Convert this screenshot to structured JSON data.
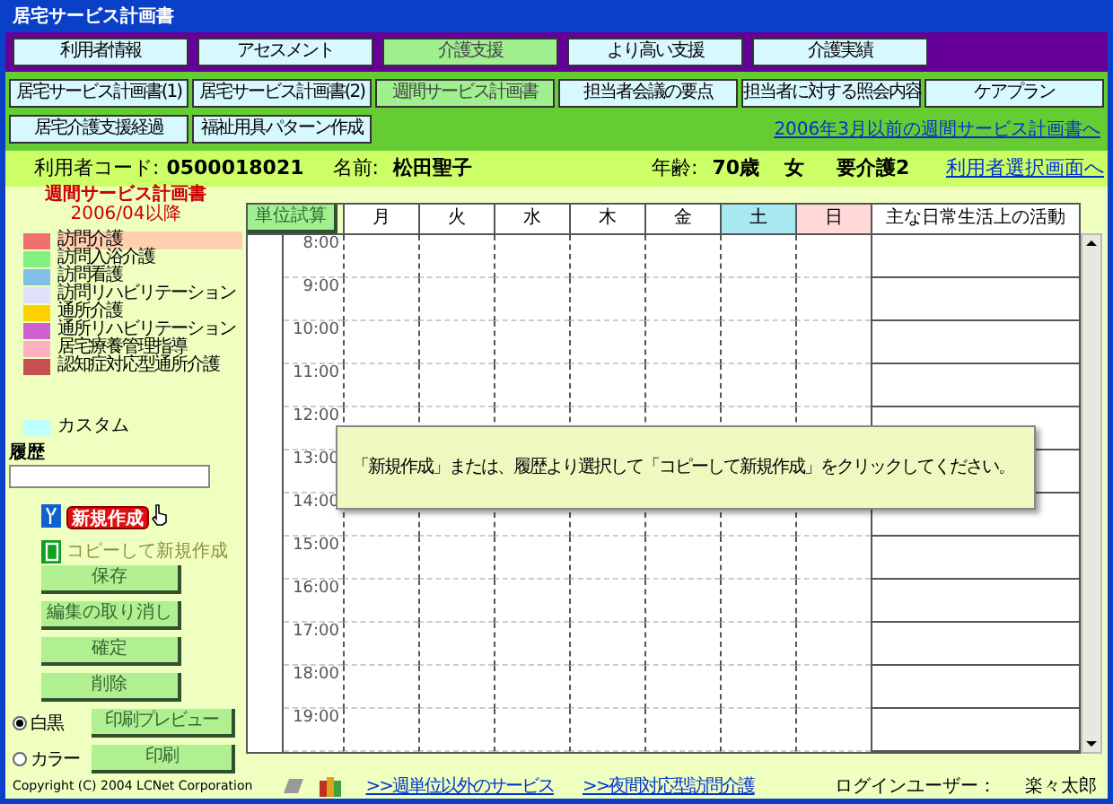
{
  "window": {
    "title": "居宅サービス計画書"
  },
  "top_tabs": [
    {
      "label": "利用者情報",
      "selected": false
    },
    {
      "label": "アセスメント",
      "selected": false
    },
    {
      "label": "介護支援",
      "selected": true
    },
    {
      "label": "より高い支援",
      "selected": false
    },
    {
      "label": "介護実績",
      "selected": false
    }
  ],
  "sub_tabs": [
    {
      "label": "居宅サービス計画書(1)",
      "selected": false
    },
    {
      "label": "居宅サービス計画書(2)",
      "selected": false
    },
    {
      "label": "週間サービス計画書",
      "selected": true
    },
    {
      "label": "担当者会議の要点",
      "selected": false
    },
    {
      "label": "担当者に対する照会内容",
      "selected": false
    },
    {
      "label": "ケアプラン",
      "selected": false
    },
    {
      "label": "居宅介護支援経過",
      "selected": false
    },
    {
      "label": "福祉用具パターン作成",
      "selected": false
    }
  ],
  "old_plan_link": "2006年3月以前の週間サービス計画書へ",
  "user_bar": {
    "code_label": "利用者コード:",
    "code": "0500018021",
    "name_label": "名前:",
    "name": "松田聖子",
    "age_label": "年齢:",
    "age": "70歳",
    "sex": "女",
    "care_level": "要介護2",
    "link": "利用者選択画面へ"
  },
  "left_panel": {
    "title": "週間サービス計画書",
    "subtitle": "2006/04以降",
    "legend": [
      {
        "label": "訪問介護",
        "color": "#f07070",
        "selected": true
      },
      {
        "label": "訪問入浴介護",
        "color": "#80f080",
        "selected": false
      },
      {
        "label": "訪問看護",
        "color": "#80c0e8",
        "selected": false
      },
      {
        "label": "訪問リハビリテーション",
        "color": "#e0e0f8",
        "selected": false
      },
      {
        "label": "通所介護",
        "color": "#ffd000",
        "selected": false
      },
      {
        "label": "通所リハビリテーション",
        "color": "#d060d0",
        "selected": false
      },
      {
        "label": "居宅療養管理指導",
        "color": "#ffb0c0",
        "selected": false
      },
      {
        "label": "認知症対応型通所介護",
        "color": "#c85050",
        "selected": false
      }
    ],
    "custom": {
      "label": "カスタム",
      "color": "#c0ffff"
    },
    "history_label": "履歴",
    "new_button": {
      "label": "新規作成",
      "highlighted": true
    },
    "copy_button": {
      "label": "コピーして新規作成",
      "disabled": true
    },
    "buttons": [
      "保存",
      "編集の取り消し",
      "確定",
      "削除"
    ],
    "print_rows": [
      {
        "label": "白黒",
        "selected": true,
        "button": "印刷プレビュー"
      },
      {
        "label": "カラー",
        "selected": false,
        "button": "印刷"
      }
    ]
  },
  "schedule": {
    "calc_button": "単位試算",
    "days": [
      {
        "label": "月",
        "kind": "weekday"
      },
      {
        "label": "火",
        "kind": "weekday"
      },
      {
        "label": "水",
        "kind": "weekday"
      },
      {
        "label": "木",
        "kind": "weekday"
      },
      {
        "label": "金",
        "kind": "weekday"
      },
      {
        "label": "土",
        "kind": "saturday"
      },
      {
        "label": "日",
        "kind": "sunday"
      }
    ],
    "activity_header": "主な日常生活上の活動",
    "hours": [
      "8:00",
      "9:00",
      "10:00",
      "11:00",
      "12:00",
      "13:00",
      "14:00",
      "15:00",
      "16:00",
      "17:00",
      "18:00",
      "19:00"
    ],
    "message": "「新規作成」または、履歴より選択して「コピーして新規作成」をクリックしてください。"
  },
  "footer": {
    "copyright": "Copyright (C) 2004 LCNet Corporation",
    "links": [
      ">>週単位以外のサービス",
      ">>夜間対応型訪問介護"
    ],
    "login_label": "ログインユーザー：",
    "login_user": "楽々太郎"
  }
}
